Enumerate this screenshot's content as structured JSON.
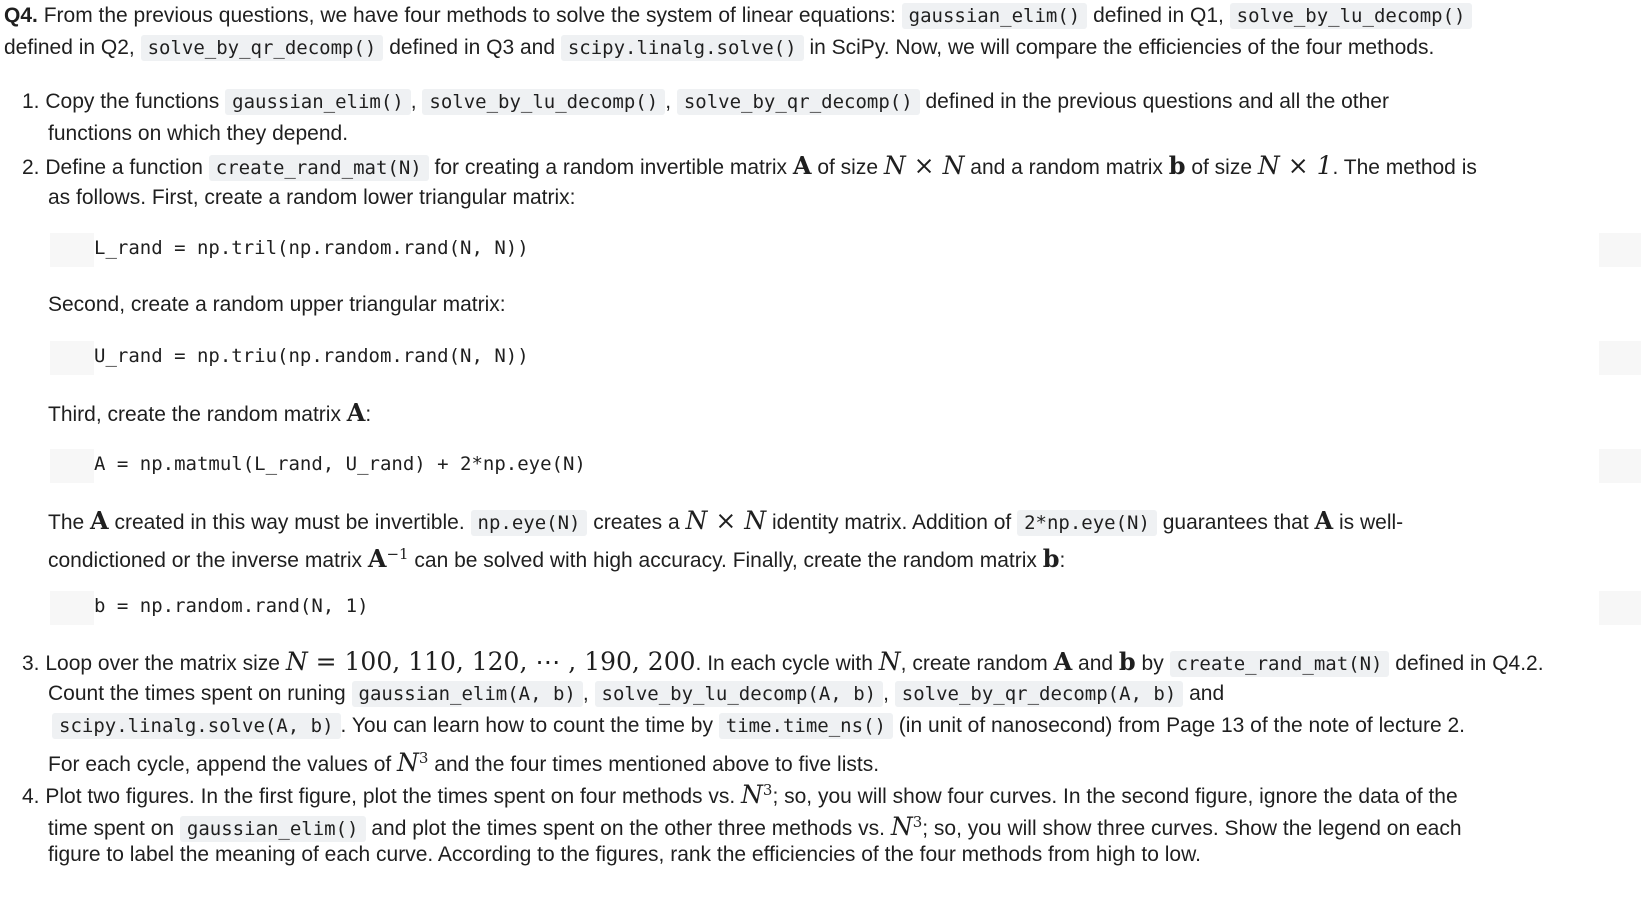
{
  "intro": {
    "label": "Q4.",
    "l1_a": " From the previous questions, we have four methods to solve the system of linear equations: ",
    "code_gauss": "gaussian_elim()",
    "l1_b": " defined in Q1, ",
    "code_lu": "solve_by_lu_decomp()",
    "l2_a": "defined in Q2, ",
    "code_qr": "solve_by_qr_decomp()",
    "l2_b": " defined in Q3 and ",
    "code_scipy": "scipy.linalg.solve()",
    "l2_c": " in SciPy. Now, we will compare the efficiencies of the four methods."
  },
  "items": [
    {
      "number": "1.",
      "l1_a": "Copy the functions ",
      "c1": "gaussian_elim()",
      "sep1": ", ",
      "c2": "solve_by_lu_decomp()",
      "sep2": ", ",
      "c3": "solve_by_qr_decomp()",
      "l1_b": " defined in the previous questions and all the other",
      "l2": "functions on which they depend."
    },
    {
      "number": "2.",
      "l1_a": "Define a function ",
      "c1": "create_rand_mat(N)",
      "l1_b": " for creating a random invertible matrix ",
      "A": "A",
      "l1_c": " of size ",
      "NxN": "N × N",
      "l1_d": " and a random matrix ",
      "b": "b",
      "l1_e": " of size ",
      "Nx1": "N × 1",
      "l1_f": ". The method is",
      "l2": "as follows. First, create a random lower triangular matrix:",
      "code1": "L_rand = np.tril(np.random.rand(N, N))",
      "second": "Second, create a random upper triangular matrix:",
      "code2": "U_rand = np.triu(np.random.rand(N, N))",
      "third_a": "Third, create the random matrix ",
      "third_b": ":",
      "code3": "A = np.matmul(L_rand, U_rand) + 2*np.eye(N)",
      "p_a": "The ",
      "p_b": " created in this way must be invertible. ",
      "p_c1": "np.eye(N)",
      "p_d": " creates a ",
      "p_e": " identity matrix. Addition of ",
      "p_c2": "2*np.eye(N)",
      "p_f": " guarantees that ",
      "p_g": " is well-",
      "p2_a": "condictioned or the inverse matrix ",
      "p2_sup": "−1",
      "p2_b": " can be solved with high accuracy. Finally, create the random matrix ",
      "p2_c": ":",
      "code4": "b = np.random.rand(N, 1)"
    },
    {
      "number": "3.",
      "l1_a": "Loop over the matrix size ",
      "N": "N",
      "eq": " = 100, 110, 120, ⋯ , 190, 200",
      "l1_b": ". In each cycle with ",
      "l1_c": ", create random ",
      "l1_d": " and ",
      "l1_e": " by ",
      "c1": "create_rand_mat(N)",
      "l1_f": " defined in Q4.2.",
      "l2_a": "Count the times spent on runing ",
      "c2": "gaussian_elim(A, b)",
      "c3": "solve_by_lu_decomp(A, b)",
      "c4": "solve_by_qr_decomp(A, b)",
      "l2_b": " and",
      "c5": "scipy.linalg.solve(A, b)",
      "l3_a": ". You can learn how to count the time by ",
      "c6": "time.time_ns()",
      "l3_b": " (in unit of nanosecond) from Page 13 of the note of lecture 2.",
      "l4_a": "For each cycle, append the values of ",
      "l4_b": " and the four times mentioned above to five lists."
    },
    {
      "number": "4.",
      "l1_a": "Plot two figures. In the first figure, plot the times spent on four methods vs. ",
      "l1_b": "; so, you will show four curves. In the second figure, ignore the data of the",
      "l2_a": "time spent on ",
      "c1": "gaussian_elim()",
      "l2_b": " and plot the times spent on the other three methods vs. ",
      "l2_c": "; so, you will show three curves. Show the legend on each",
      "l3": "figure to label the meaning of each curve. According to the figures, rank the efficiencies of the four methods from high to low."
    }
  ],
  "math": {
    "N": "N",
    "exp3": "3",
    "comma_sep": ", "
  }
}
